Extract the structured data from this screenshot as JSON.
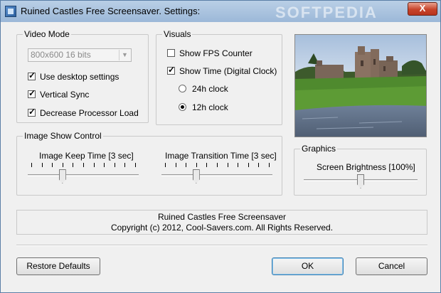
{
  "window": {
    "title": "Ruined Castles Free Screensaver. Settings:",
    "close_label": "X",
    "watermark": "SOFTPEDIA"
  },
  "video_mode": {
    "legend": "Video Mode",
    "resolution_selected": "800x600 16 bits",
    "use_desktop_settings": {
      "label": "Use desktop settings",
      "checked": true
    },
    "vertical_sync": {
      "label": "Vertical Sync",
      "checked": true
    },
    "decrease_processor_load": {
      "label": "Decrease Processor Load",
      "checked": true
    }
  },
  "visuals": {
    "legend": "Visuals",
    "show_fps": {
      "label": "Show FPS Counter",
      "checked": false
    },
    "show_time": {
      "label": "Show Time (Digital Clock)",
      "checked": true
    },
    "clock_24h": {
      "label": "24h clock",
      "selected": false
    },
    "clock_12h": {
      "label": "12h clock",
      "selected": true
    }
  },
  "image_show_control": {
    "legend": "Image Show Control",
    "keep_time": {
      "label": "Image Keep Time [3 sec]",
      "value": 3,
      "min": 0,
      "max": 10
    },
    "transition_time": {
      "label": "Image Transition Time [3 sec]",
      "value": 3,
      "min": 0,
      "max": 10
    }
  },
  "graphics": {
    "legend": "Graphics",
    "brightness": {
      "label": "Screen Brightness [100%]",
      "percent": 100,
      "fraction": 0.5
    }
  },
  "info": {
    "line1": "Ruined Castles Free Screensaver",
    "line2": "Copyright (c) 2012, Cool-Savers.com. All Rights Reserved."
  },
  "buttons": {
    "restore_defaults": "Restore Defaults",
    "ok": "OK",
    "cancel": "Cancel"
  },
  "colors": {
    "titlebar": "#9cb8d8",
    "window_bg": "#f0f0f0",
    "close_button": "#c7432a"
  }
}
